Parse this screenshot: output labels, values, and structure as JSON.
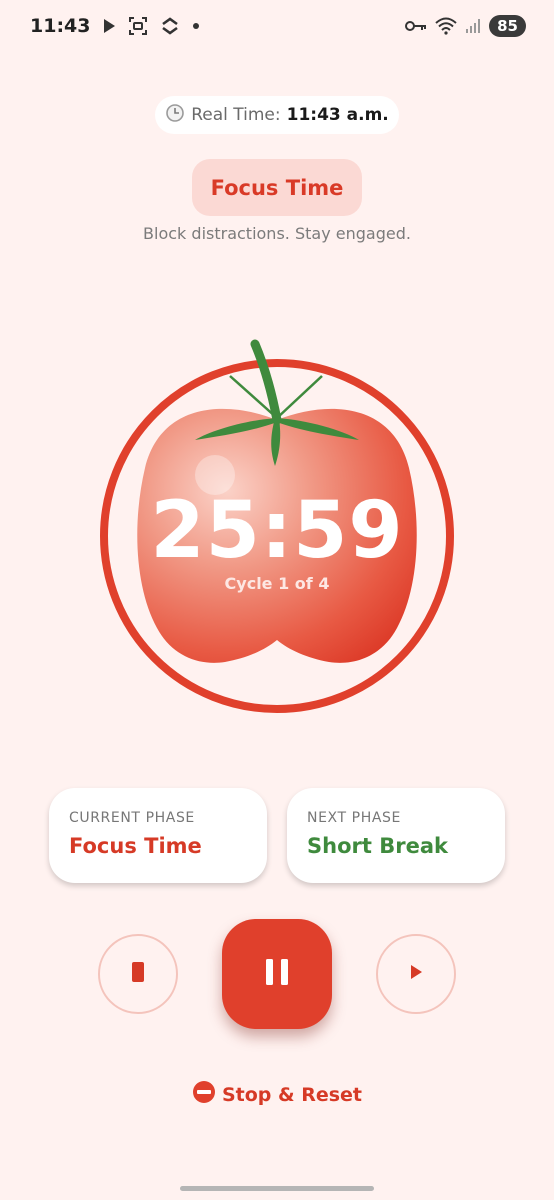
{
  "status_bar": {
    "time": "11:43",
    "battery": "85",
    "icons": [
      "play-icon",
      "screenshot-icon",
      "app-icon",
      "dot-icon",
      "key-icon",
      "wifi-icon",
      "signal-icon"
    ]
  },
  "real_time": {
    "label": "Real Time:",
    "value": "11:43 a.m.",
    "icon": "clock-icon"
  },
  "phase_chip": {
    "label": "Focus Time"
  },
  "subtitle": "Block distractions. Stay engaged.",
  "timer": {
    "time": "25:59",
    "cycle": "Cycle 1 of 4"
  },
  "phases": {
    "current_label": "CURRENT PHASE",
    "current_value": "Focus Time",
    "next_label": "NEXT PHASE",
    "next_value": "Short Break"
  },
  "controls": {
    "stop_icon": "stop-icon",
    "pause_icon": "pause-icon",
    "skip_icon": "skip-icon"
  },
  "stop_reset": {
    "icon": "no-entry-icon",
    "label": "Stop & Reset"
  },
  "colors": {
    "background": "#fff2f0",
    "accent": "#e0402c",
    "tomato_red": "#e03c2b",
    "leaf_green": "#3f8a3d",
    "chip_bg": "#fbd9d4"
  }
}
